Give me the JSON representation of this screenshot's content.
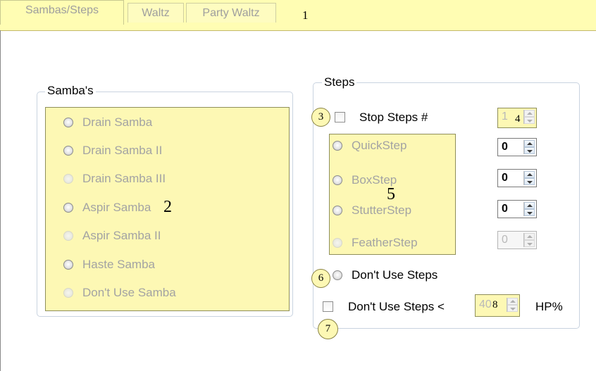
{
  "tabs": [
    {
      "label": "Sambas/Steps",
      "active": true
    },
    {
      "label": "Waltz",
      "active": false
    },
    {
      "label": "Party Waltz",
      "active": false
    }
  ],
  "annotations": {
    "a1": "1",
    "a2": "2",
    "a3": "3",
    "a4": "4",
    "a5": "5",
    "a6": "6",
    "a7": "7",
    "a8": "8"
  },
  "sambas": {
    "legend": "Samba's",
    "options": [
      {
        "label": "Drain Samba",
        "enabled": true
      },
      {
        "label": "Drain Samba II",
        "enabled": true
      },
      {
        "label": "Drain Samba III",
        "enabled": false
      },
      {
        "label": "Aspir Samba",
        "enabled": true
      },
      {
        "label": "Aspir Samba II",
        "enabled": false
      },
      {
        "label": "Haste Samba",
        "enabled": true
      },
      {
        "label": "Don't Use Samba",
        "enabled": false
      }
    ]
  },
  "steps": {
    "legend": "Steps",
    "stop_steps": {
      "label": "Stop Steps #",
      "checked": false,
      "value": "1"
    },
    "options": [
      {
        "label": "QuickStep",
        "value": "0",
        "enabled": true
      },
      {
        "label": "BoxStep",
        "value": "0",
        "enabled": true
      },
      {
        "label": "StutterStep",
        "value": "0",
        "enabled": true
      },
      {
        "label": "FeatherStep",
        "value": "0",
        "enabled": false
      }
    ],
    "dont_use_steps": {
      "label": "Don't Use Steps",
      "selected": false
    },
    "hp_threshold": {
      "label": "Don't Use Steps <",
      "checked": false,
      "value": "40",
      "suffix": "HP%"
    }
  },
  "colors": {
    "highlight": "#fdf8b4",
    "tab_bar": "#fffdb3",
    "group_border": "#c9d3e0"
  }
}
